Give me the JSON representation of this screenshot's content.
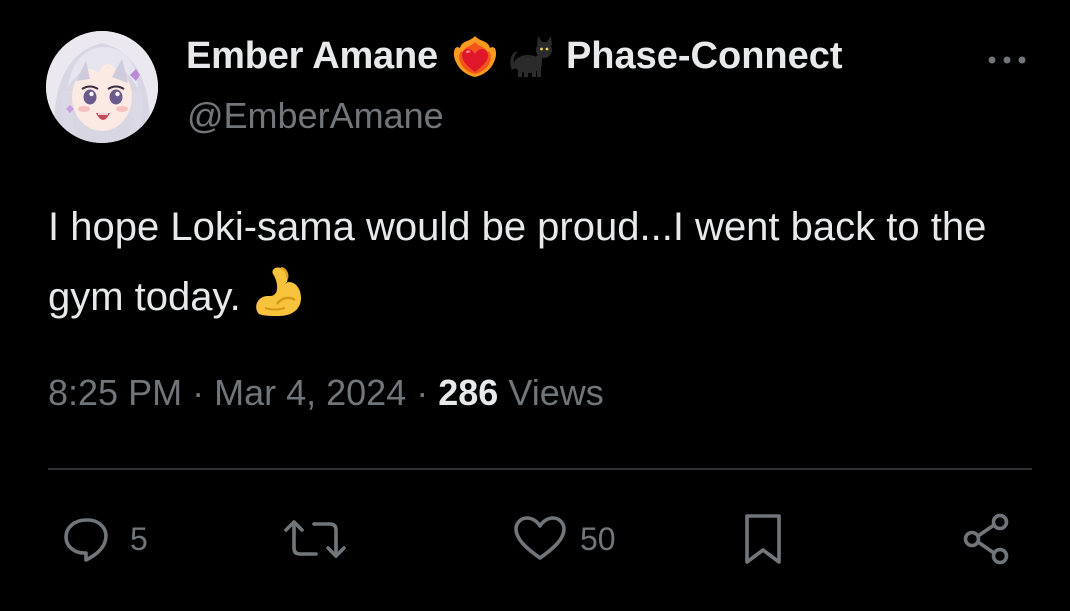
{
  "author": {
    "display_name": "Ember Amane",
    "emojis": [
      "heart-on-fire-icon",
      "black-cat-icon"
    ],
    "affiliation": "Phase-Connect",
    "handle": "@EmberAmane"
  },
  "tweet": {
    "text": "I hope Loki-sama would be proud...I went back to the gym today.",
    "emoji": "flexed-biceps-icon"
  },
  "meta": {
    "time": "8:25 PM",
    "separator": "·",
    "date": "Mar 4, 2024",
    "views_count": "286",
    "views_label": "Views"
  },
  "actions": {
    "replies": "5",
    "retweets": "",
    "likes": "50"
  },
  "colors": {
    "background": "#000000",
    "text_primary": "#e7e9ea",
    "text_secondary": "#71767b",
    "divider": "#2f3336"
  }
}
